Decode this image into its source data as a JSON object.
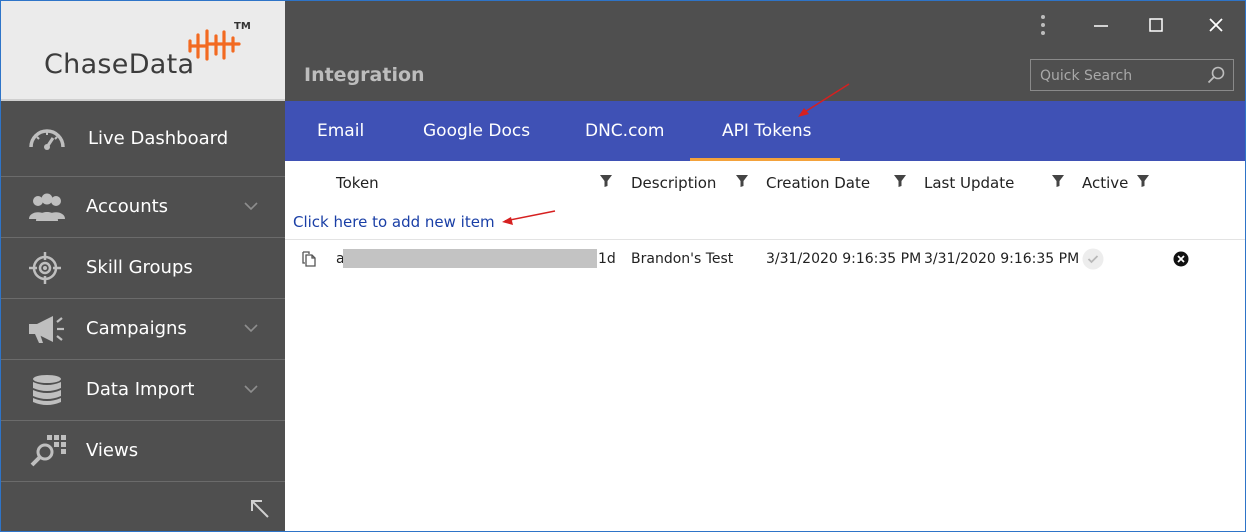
{
  "logo": {
    "text": "ChaseData",
    "tm": "TM"
  },
  "sidebar": {
    "items": [
      {
        "label": "Live Dashboard",
        "icon": "speedometer-icon",
        "has_chevron": false
      },
      {
        "label": "Accounts",
        "icon": "users-icon",
        "has_chevron": true
      },
      {
        "label": "Skill Groups",
        "icon": "crosshair-icon",
        "has_chevron": false
      },
      {
        "label": "Campaigns",
        "icon": "megaphone-icon",
        "has_chevron": true
      },
      {
        "label": "Data Import",
        "icon": "database-icon",
        "has_chevron": true
      },
      {
        "label": "Views",
        "icon": "magnifier-grid-icon",
        "has_chevron": false
      }
    ]
  },
  "header": {
    "title": "Integration",
    "search_placeholder": "Quick Search"
  },
  "tabs": [
    {
      "label": "Email",
      "active": false
    },
    {
      "label": "Google Docs",
      "active": false
    },
    {
      "label": "DNC.com",
      "active": false
    },
    {
      "label": "API Tokens",
      "active": true
    }
  ],
  "grid": {
    "columns": [
      "Token",
      "Description",
      "Creation Date",
      "Last Update",
      "Active"
    ],
    "add_item": "Click here to add new item",
    "rows": [
      {
        "token_start": "a",
        "token_end": "1d",
        "description": "Brandon's Test",
        "creation_date": "3/31/2020 9:16:35 PM",
        "last_update": "3/31/2020 9:16:35 PM",
        "active": true
      }
    ]
  },
  "colors": {
    "sidebar_bg": "#4f4f4f",
    "tab_bar": "#3f51b5",
    "tab_active_underline": "#f4a23b",
    "link": "#1a3fa6",
    "logo_orange": "#f26a21"
  }
}
